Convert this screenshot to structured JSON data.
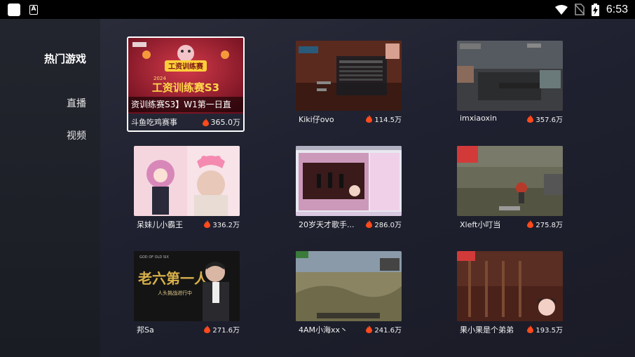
{
  "status_bar": {
    "time": "6:53",
    "icons": [
      "app-square-icon",
      "a-notification-icon",
      "wifi-icon",
      "no-sim-icon",
      "battery-charging-icon"
    ]
  },
  "sidebar": {
    "title": "热门游戏",
    "items": [
      {
        "label": "直播"
      },
      {
        "label": "视频"
      }
    ]
  },
  "cards": [
    {
      "name": "斗鱼吃鸡赛事",
      "hot": "365.0万",
      "caption": "资训练赛S3】W1第一日直",
      "focused": true
    },
    {
      "name": "Kiki仔ovo",
      "hot": "114.5万"
    },
    {
      "name": "imxiaoxin",
      "hot": "357.6万"
    },
    {
      "name": "呆妹儿小霸王",
      "hot": "336.2万"
    },
    {
      "name": "20岁天才歌手...",
      "hot": "286.0万"
    },
    {
      "name": "Xleft小叮当",
      "hot": "275.8万"
    },
    {
      "name": "邦Sa",
      "hot": "271.6万"
    },
    {
      "name": "4AM小海xx丶",
      "hot": "241.6万"
    },
    {
      "name": "果小果是个弟弟",
      "hot": "193.5万"
    }
  ],
  "thumb_texts": {
    "card1_main": "工资训练赛S3",
    "card1_sub": "工资训练赛",
    "card1_year": "2024",
    "card7_main": "老六第一人",
    "card7_sub": "人头挑战进行中",
    "card7_top": "GOD OF OLD SIX"
  },
  "colors": {
    "flame": "#ff4a1c",
    "focus_border": "#ffffff",
    "sidebar_bg": "#23252e",
    "main_bg": "#1f2130"
  }
}
